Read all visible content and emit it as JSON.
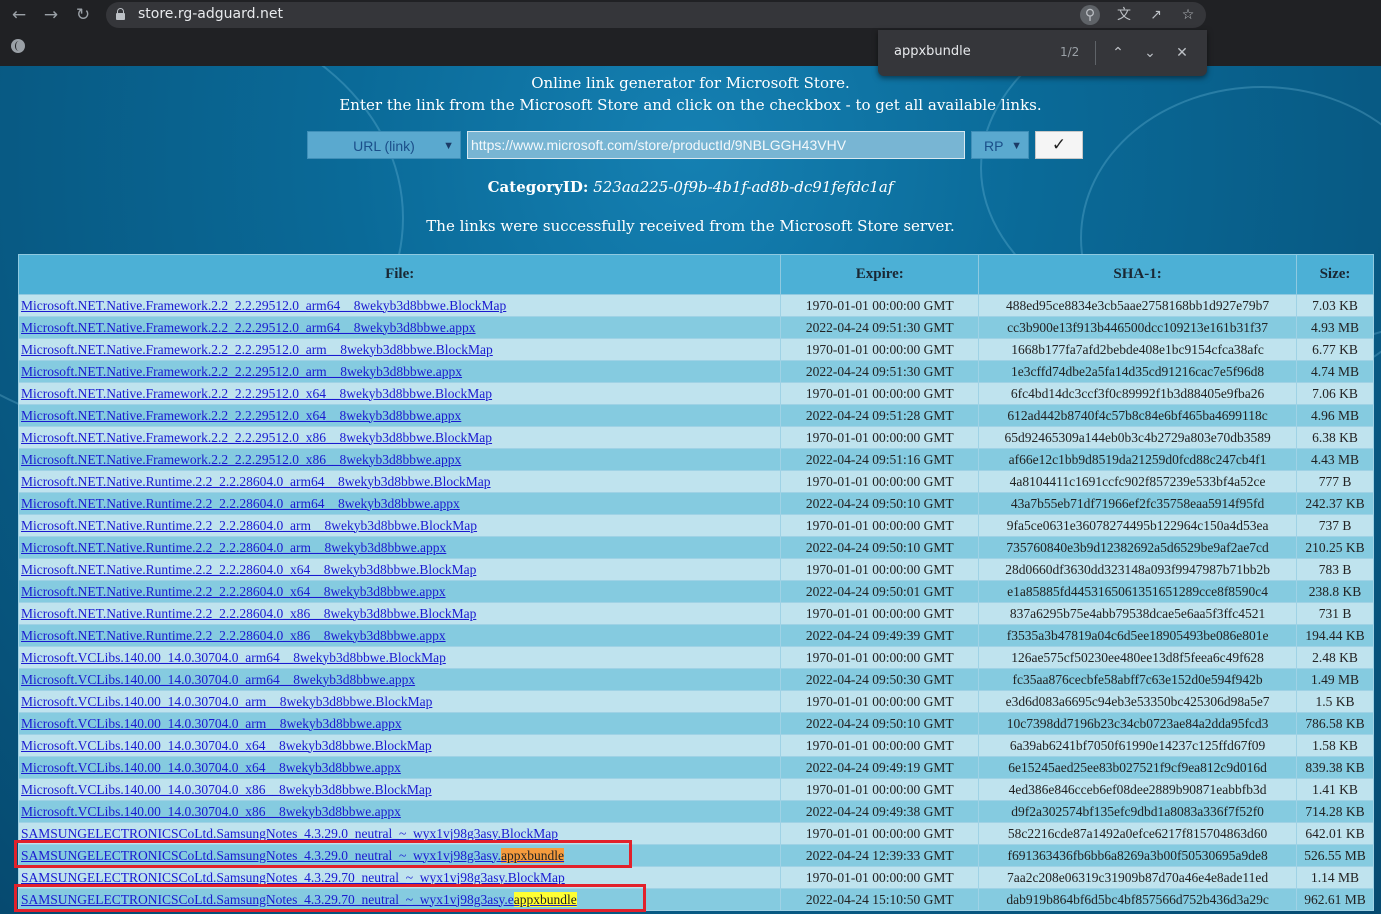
{
  "browser": {
    "url": "store.rg-adguard.net",
    "find": {
      "query": "appxbundle",
      "count": "1/2"
    }
  },
  "intro": {
    "line1": "Online link generator for Microsoft Store.",
    "line2": "Enter the link from the Microsoft Store and click on the checkbox - to get all available links."
  },
  "form": {
    "type_select": "URL (link)",
    "url_value": "https://www.microsoft.com/store/productId/9NBLGGH43VHV",
    "ring_select": "RP",
    "submit_label": "✓"
  },
  "category": {
    "label": "CategoryID:",
    "value": "523aa225-0f9b-4b1f-ad8b-dc91fefdc1af"
  },
  "status": "The links were successfully received from the Microsoft Store server.",
  "table": {
    "headers": [
      "File:",
      "Expire:",
      "SHA-1:",
      "Size:"
    ],
    "rows": [
      {
        "file": "Microsoft.NET.Native.Framework.2.2_2.2.29512.0_arm64__8wekyb3d8bbwe.BlockMap",
        "expire": "1970-01-01 00:00:00 GMT",
        "sha": "488ed95ce8834e3cb5aae2758168bb1d927e79b7",
        "size": "7.03 KB"
      },
      {
        "file": "Microsoft.NET.Native.Framework.2.2_2.2.29512.0_arm64__8wekyb3d8bbwe.appx",
        "expire": "2022-04-24 09:51:30 GMT",
        "sha": "cc3b900e13f913b446500dcc109213e161b31f37",
        "size": "4.93 MB"
      },
      {
        "file": "Microsoft.NET.Native.Framework.2.2_2.2.29512.0_arm__8wekyb3d8bbwe.BlockMap",
        "expire": "1970-01-01 00:00:00 GMT",
        "sha": "1668b177fa7afd2bebde408e1bc9154cfca38afc",
        "size": "6.77 KB"
      },
      {
        "file": "Microsoft.NET.Native.Framework.2.2_2.2.29512.0_arm__8wekyb3d8bbwe.appx",
        "expire": "2022-04-24 09:51:30 GMT",
        "sha": "1e3cffd74dbe2a5fa14d35cd91216cac7e5f96d8",
        "size": "4.74 MB"
      },
      {
        "file": "Microsoft.NET.Native.Framework.2.2_2.2.29512.0_x64__8wekyb3d8bbwe.BlockMap",
        "expire": "1970-01-01 00:00:00 GMT",
        "sha": "6fc4bd14dc3ccf3f0c89992f1b3d88405e9fba26",
        "size": "7.06 KB"
      },
      {
        "file": "Microsoft.NET.Native.Framework.2.2_2.2.29512.0_x64__8wekyb3d8bbwe.appx",
        "expire": "2022-04-24 09:51:28 GMT",
        "sha": "612ad442b8740f4c57b8c84e6bf465ba4699118c",
        "size": "4.96 MB"
      },
      {
        "file": "Microsoft.NET.Native.Framework.2.2_2.2.29512.0_x86__8wekyb3d8bbwe.BlockMap",
        "expire": "1970-01-01 00:00:00 GMT",
        "sha": "65d92465309a144eb0b3c4b2729a803e70db3589",
        "size": "6.38 KB"
      },
      {
        "file": "Microsoft.NET.Native.Framework.2.2_2.2.29512.0_x86__8wekyb3d8bbwe.appx",
        "expire": "2022-04-24 09:51:16 GMT",
        "sha": "af66e12c1bb9d8519da21259d0fcd88c247cb4f1",
        "size": "4.43 MB"
      },
      {
        "file": "Microsoft.NET.Native.Runtime.2.2_2.2.28604.0_arm64__8wekyb3d8bbwe.BlockMap",
        "expire": "1970-01-01 00:00:00 GMT",
        "sha": "4a8104411c1691ccfc902f857239e533bf4a52ce",
        "size": "777 B"
      },
      {
        "file": "Microsoft.NET.Native.Runtime.2.2_2.2.28604.0_arm64__8wekyb3d8bbwe.appx",
        "expire": "2022-04-24 09:50:10 GMT",
        "sha": "43a7b55eb71df71966ef2fc35758eaa5914f95fd",
        "size": "242.37 KB"
      },
      {
        "file": "Microsoft.NET.Native.Runtime.2.2_2.2.28604.0_arm__8wekyb3d8bbwe.BlockMap",
        "expire": "1970-01-01 00:00:00 GMT",
        "sha": "9fa5ce0631e36078274495b122964c150a4d53ea",
        "size": "737 B"
      },
      {
        "file": "Microsoft.NET.Native.Runtime.2.2_2.2.28604.0_arm__8wekyb3d8bbwe.appx",
        "expire": "2022-04-24 09:50:10 GMT",
        "sha": "735760840e3b9d12382692a5d6529be9af2ae7cd",
        "size": "210.25 KB"
      },
      {
        "file": "Microsoft.NET.Native.Runtime.2.2_2.2.28604.0_x64__8wekyb3d8bbwe.BlockMap",
        "expire": "1970-01-01 00:00:00 GMT",
        "sha": "28d0660df3630dd323148a093f9947987b71bb2b",
        "size": "783 B"
      },
      {
        "file": "Microsoft.NET.Native.Runtime.2.2_2.2.28604.0_x64__8wekyb3d8bbwe.appx",
        "expire": "2022-04-24 09:50:01 GMT",
        "sha": "e1a85885fd4453165061351651289cce8f8590c4",
        "size": "238.8 KB"
      },
      {
        "file": "Microsoft.NET.Native.Runtime.2.2_2.2.28604.0_x86__8wekyb3d8bbwe.BlockMap",
        "expire": "1970-01-01 00:00:00 GMT",
        "sha": "837a6295b75e4abb79538dcae5e6aa5f3ffc4521",
        "size": "731 B"
      },
      {
        "file": "Microsoft.NET.Native.Runtime.2.2_2.2.28604.0_x86__8wekyb3d8bbwe.appx",
        "expire": "2022-04-24 09:49:39 GMT",
        "sha": "f3535a3b47819a04c6d5ee18905493be086e801e",
        "size": "194.44 KB"
      },
      {
        "file": "Microsoft.VCLibs.140.00_14.0.30704.0_arm64__8wekyb3d8bbwe.BlockMap",
        "expire": "1970-01-01 00:00:00 GMT",
        "sha": "126ae575cf50230ee480ee13d8f5feea6c49f628",
        "size": "2.48 KB"
      },
      {
        "file": "Microsoft.VCLibs.140.00_14.0.30704.0_arm64__8wekyb3d8bbwe.appx",
        "expire": "2022-04-24 09:50:30 GMT",
        "sha": "fc35aa876cecbfe58abff7c63e152d0e594f942b",
        "size": "1.49 MB"
      },
      {
        "file": "Microsoft.VCLibs.140.00_14.0.30704.0_arm__8wekyb3d8bbwe.BlockMap",
        "expire": "1970-01-01 00:00:00 GMT",
        "sha": "e3d6d083a6695c94eb3e53350bc425306d98a5e7",
        "size": "1.5 KB"
      },
      {
        "file": "Microsoft.VCLibs.140.00_14.0.30704.0_arm__8wekyb3d8bbwe.appx",
        "expire": "2022-04-24 09:50:10 GMT",
        "sha": "10c7398dd7196b23c34cb0723ae84a2dda95fcd3",
        "size": "786.58 KB"
      },
      {
        "file": "Microsoft.VCLibs.140.00_14.0.30704.0_x64__8wekyb3d8bbwe.BlockMap",
        "expire": "1970-01-01 00:00:00 GMT",
        "sha": "6a39ab6241bf7050f61990e14237c125ffd67f09",
        "size": "1.58 KB"
      },
      {
        "file": "Microsoft.VCLibs.140.00_14.0.30704.0_x64__8wekyb3d8bbwe.appx",
        "expire": "2022-04-24 09:49:19 GMT",
        "sha": "6e15245aed25ee83b027521f9cf9ea812c9d016d",
        "size": "839.38 KB"
      },
      {
        "file": "Microsoft.VCLibs.140.00_14.0.30704.0_x86__8wekyb3d8bbwe.BlockMap",
        "expire": "1970-01-01 00:00:00 GMT",
        "sha": "4ed386e846cceb6ef08dee2889b90871eabbfb3d",
        "size": "1.41 KB"
      },
      {
        "file": "Microsoft.VCLibs.140.00_14.0.30704.0_x86__8wekyb3d8bbwe.appx",
        "expire": "2022-04-24 09:49:38 GMT",
        "sha": "d9f2a302574bf135efc9dbd1a8083a336f7f52f0",
        "size": "714.28 KB"
      },
      {
        "file": "SAMSUNGELECTRONICSCoLtd.SamsungNotes_4.3.29.0_neutral_~_wyx1vj98g3asy.BlockMap",
        "expire": "1970-01-01 00:00:00 GMT",
        "sha": "58c2216cde87a1492a0efce6217f815704863d60",
        "size": "642.01 KB"
      },
      {
        "file_prefix": "SAMSUNGELECTRONICSCoLtd.SamsungNotes_4.3.29.0_neutral_~_wyx1vj98g3asy.",
        "file_match": "appxbundle",
        "match": "current",
        "expire": "2022-04-24 12:39:33 GMT",
        "sha": "f691363436fb6bb6a8269a3b00f50530695a9de8",
        "size": "526.55 MB"
      },
      {
        "file": "SAMSUNGELECTRONICSCoLtd.SamsungNotes_4.3.29.70_neutral_~_wyx1vj98g3asy.BlockMap",
        "expire": "1970-01-01 00:00:00 GMT",
        "sha": "7aa2c208e06319c31909b87d70a46e4e8ade11ed",
        "size": "1.14 MB"
      },
      {
        "file_prefix": "SAMSUNGELECTRONICSCoLtd.SamsungNotes_4.3.29.70_neutral_~_wyx1vj98g3asy.e",
        "file_match": "appxbundle",
        "match": "other",
        "expire": "2022-04-24 15:10:50 GMT",
        "sha": "dab919b864bf6d5bc4bf857566d752b436d3a29c",
        "size": "962.61 MB"
      }
    ]
  }
}
